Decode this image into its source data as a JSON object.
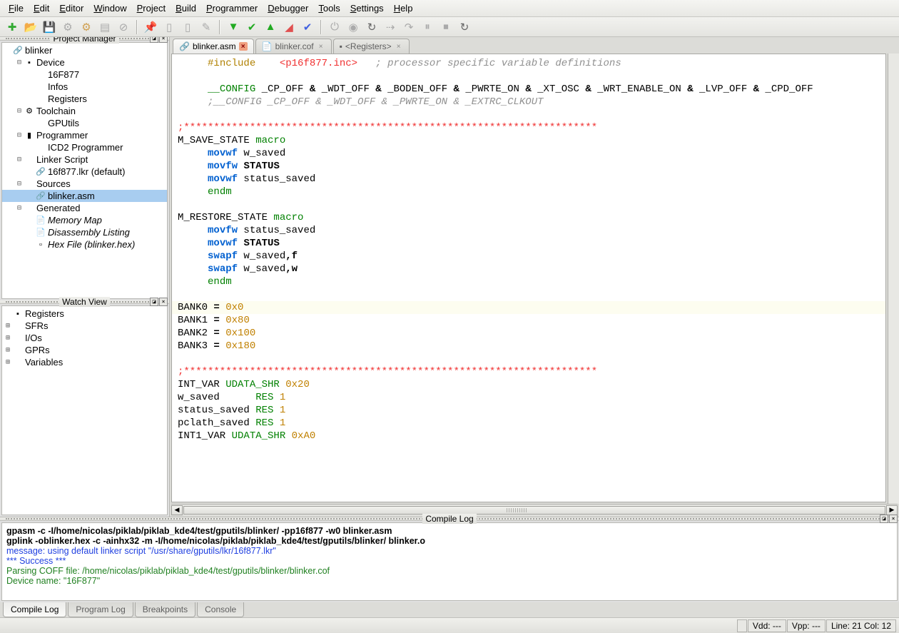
{
  "menu": [
    "File",
    "Edit",
    "Editor",
    "Window",
    "Project",
    "Build",
    "Programmer",
    "Debugger",
    "Tools",
    "Settings",
    "Help"
  ],
  "toolbar_icons": [
    {
      "name": "new-file-icon",
      "glyph": "✚",
      "color": "#3a3"
    },
    {
      "name": "open-file-icon",
      "glyph": "📂",
      "color": "#c8a040"
    },
    {
      "name": "save-icon",
      "glyph": "💾",
      "color": "#446"
    },
    {
      "name": "gear-icon",
      "glyph": "⚙",
      "color": "#aaa"
    },
    {
      "name": "config-icon",
      "glyph": "⚙",
      "color": "#d0a050"
    },
    {
      "name": "doc-icon",
      "glyph": "▤",
      "color": "#aaa"
    },
    {
      "name": "stop-icon",
      "glyph": "⊘",
      "color": "#aaa"
    },
    {
      "sep": true
    },
    {
      "name": "pin-icon",
      "glyph": "📌",
      "color": "#2a2"
    },
    {
      "name": "chip-icon",
      "glyph": "▯",
      "color": "#aaa"
    },
    {
      "name": "chip2-icon",
      "glyph": "▯",
      "color": "#aaa"
    },
    {
      "name": "wand-icon",
      "glyph": "✎",
      "color": "#aaa"
    },
    {
      "sep": true
    },
    {
      "name": "run-icon",
      "glyph": "▼",
      "color": "#2a2"
    },
    {
      "name": "check-icon",
      "glyph": "✔",
      "color": "#2a2"
    },
    {
      "name": "up-icon",
      "glyph": "▲",
      "color": "#2a2"
    },
    {
      "name": "erase-icon",
      "glyph": "◢",
      "color": "#e05050"
    },
    {
      "name": "verify-icon",
      "glyph": "✔",
      "color": "#4060e0"
    },
    {
      "sep": true
    },
    {
      "name": "power-icon",
      "glyph": "⏻",
      "color": "#aaa"
    },
    {
      "name": "circle-icon",
      "glyph": "◉",
      "color": "#aaa"
    },
    {
      "name": "reload-icon",
      "glyph": "↻",
      "color": "#666"
    },
    {
      "name": "connect-icon",
      "glyph": "⇢",
      "color": "#aaa"
    },
    {
      "name": "step-icon",
      "glyph": "↷",
      "color": "#aaa"
    },
    {
      "name": "pause-icon",
      "glyph": "⏸",
      "color": "#aaa"
    },
    {
      "name": "stop2-icon",
      "glyph": "⏹",
      "color": "#aaa"
    },
    {
      "name": "reload2-icon",
      "glyph": "↻",
      "color": "#666"
    }
  ],
  "panels": {
    "project": "Project Manager",
    "watch": "Watch View",
    "compile": "Compile Log"
  },
  "project_tree": [
    {
      "d": 0,
      "exp": "",
      "ico": "🔗",
      "lbl": "blinker"
    },
    {
      "d": 1,
      "exp": "⊟",
      "ico": "▪",
      "lbl": "Device"
    },
    {
      "d": 2,
      "exp": "",
      "ico": "",
      "lbl": "16F877"
    },
    {
      "d": 2,
      "exp": "",
      "ico": "",
      "lbl": "Infos"
    },
    {
      "d": 2,
      "exp": "",
      "ico": "",
      "lbl": "Registers"
    },
    {
      "d": 1,
      "exp": "⊟",
      "ico": "⚙",
      "lbl": "Toolchain"
    },
    {
      "d": 2,
      "exp": "",
      "ico": "",
      "lbl": "GPUtils"
    },
    {
      "d": 1,
      "exp": "⊟",
      "ico": "▮",
      "lbl": "Programmer"
    },
    {
      "d": 2,
      "exp": "",
      "ico": "",
      "lbl": "ICD2 Programmer"
    },
    {
      "d": 1,
      "exp": "⊟",
      "ico": "",
      "lbl": "Linker Script"
    },
    {
      "d": 2,
      "exp": "",
      "ico": "🔗",
      "lbl": "16f877.lkr (default)"
    },
    {
      "d": 1,
      "exp": "⊟",
      "ico": "",
      "lbl": "Sources"
    },
    {
      "d": 2,
      "exp": "",
      "ico": "🔗",
      "lbl": "blinker.asm",
      "sel": true
    },
    {
      "d": 1,
      "exp": "⊟",
      "ico": "",
      "lbl": "Generated"
    },
    {
      "d": 2,
      "exp": "",
      "ico": "📄",
      "lbl": "Memory Map",
      "italic": true
    },
    {
      "d": 2,
      "exp": "",
      "ico": "📄",
      "lbl": "Disassembly Listing",
      "italic": true
    },
    {
      "d": 2,
      "exp": "",
      "ico": "▫",
      "lbl": "Hex File (blinker.hex)",
      "italic": true
    }
  ],
  "watch_tree": [
    {
      "d": 0,
      "exp": "",
      "ico": "▪",
      "lbl": "Registers"
    },
    {
      "d": 0,
      "exp": "⊞",
      "ico": "",
      "lbl": "SFRs"
    },
    {
      "d": 0,
      "exp": "⊞",
      "ico": "",
      "lbl": "I/Os"
    },
    {
      "d": 0,
      "exp": "⊞",
      "ico": "",
      "lbl": "GPRs"
    },
    {
      "d": 0,
      "exp": "⊞",
      "ico": "",
      "lbl": "Variables"
    }
  ],
  "tabs": [
    {
      "ico": "🔗",
      "lbl": "blinker.asm",
      "active": true
    },
    {
      "ico": "📄",
      "lbl": "blinker.cof",
      "active": false
    },
    {
      "ico": "▪",
      "lbl": "<Registers>",
      "active": false
    }
  ],
  "code_lines": [
    {
      "html": "     <span class='c-pre'>#include</span>    <span class='c-inc'>&lt;p16f877.inc&gt;</span>   <span class='c-com'>; processor specific variable definitions</span>"
    },
    {
      "html": ""
    },
    {
      "html": "     <span class='c-grn'>__CONFIG</span> _CP_OFF <span class='c-b'>&amp;</span> _WDT_OFF <span class='c-b'>&amp;</span> _BODEN_OFF <span class='c-b'>&amp;</span> _PWRTE_ON <span class='c-b'>&amp;</span> _XT_OSC <span class='c-b'>&amp;</span> _WRT_ENABLE_ON <span class='c-b'>&amp;</span> _LVP_OFF <span class='c-b'>&amp;</span> _CPD_OFF"
    },
    {
      "html": "     <span class='c-com'>;__CONFIG _CP_OFF &amp; _WDT_OFF &amp; _PWRTE_ON &amp; _EXTRC_CLKOUT</span>"
    },
    {
      "html": ""
    },
    {
      "html": "<span class='c-red'>;*********************************************************************</span>"
    },
    {
      "html": "M_SAVE_STATE <span class='c-grn'>macro</span>"
    },
    {
      "html": "     <span class='c-key'>movwf</span> w_saved"
    },
    {
      "html": "     <span class='c-key'>movfw</span> <span class='c-b'>STATUS</span>"
    },
    {
      "html": "     <span class='c-key'>movwf</span> status_saved"
    },
    {
      "html": "     <span class='c-grn'>endm</span>"
    },
    {
      "html": ""
    },
    {
      "html": "M_RESTORE_STATE <span class='c-grn'>macro</span>"
    },
    {
      "html": "     <span class='c-key'>movfw</span> status_saved"
    },
    {
      "html": "     <span class='c-key'>movwf</span> <span class='c-b'>STATUS</span>"
    },
    {
      "html": "     <span class='c-key'>swapf</span> w_saved<span class='c-b'>,f</span>"
    },
    {
      "html": "     <span class='c-key'>swapf</span> w_saved<span class='c-b'>,w</span>"
    },
    {
      "html": "     <span class='c-grn'>endm</span>"
    },
    {
      "html": ""
    },
    {
      "html": "BANK0 <span class='c-b'>=</span> <span class='c-num'>0x0</span>",
      "hl": true
    },
    {
      "html": "BANK1 <span class='c-b'>=</span> <span class='c-num'>0x80</span>"
    },
    {
      "html": "BANK2 <span class='c-b'>=</span> <span class='c-num'>0x100</span>"
    },
    {
      "html": "BANK3 <span class='c-b'>=</span> <span class='c-num'>0x180</span>"
    },
    {
      "html": ""
    },
    {
      "html": "<span class='c-red'>;*********************************************************************</span>"
    },
    {
      "html": "INT_VAR <span class='c-grn'>UDATA_SHR</span> <span class='c-num'>0x20</span>"
    },
    {
      "html": "w_saved      <span class='c-grn'>RES</span> <span class='c-num'>1</span>"
    },
    {
      "html": "status_saved <span class='c-grn'>RES</span> <span class='c-num'>1</span>"
    },
    {
      "html": "pclath_saved <span class='c-grn'>RES</span> <span class='c-num'>1</span>"
    },
    {
      "html": "INT1_VAR <span class='c-grn'>UDATA_SHR</span> <span class='c-num'>0xA0</span>"
    }
  ],
  "log_lines": [
    {
      "cls": "bold",
      "txt": "gpasm -c -I/home/nicolas/piklab/piklab_kde4/test/gputils/blinker/ -pp16f877 -w0 blinker.asm"
    },
    {
      "cls": "bold",
      "txt": "gplink -oblinker.hex -c -ainhx32 -m -I/home/nicolas/piklab/piklab_kde4/test/gputils/blinker/ blinker.o"
    },
    {
      "cls": "blue",
      "txt": "message: using default linker script \"/usr/share/gputils/lkr/16f877.lkr\""
    },
    {
      "cls": "blue",
      "txt": "*** Success ***"
    },
    {
      "cls": "green",
      "txt": "Parsing COFF file: /home/nicolas/piklab/piklab_kde4/test/gputils/blinker/blinker.cof"
    },
    {
      "cls": "green",
      "txt": "Device name: \"16F877\""
    }
  ],
  "bottom_tabs": [
    "Compile Log",
    "Program Log",
    "Breakpoints",
    "Console"
  ],
  "status": {
    "vdd": "Vdd: ---",
    "vpp": "Vpp: ---",
    "pos": "Line: 21 Col: 12"
  }
}
